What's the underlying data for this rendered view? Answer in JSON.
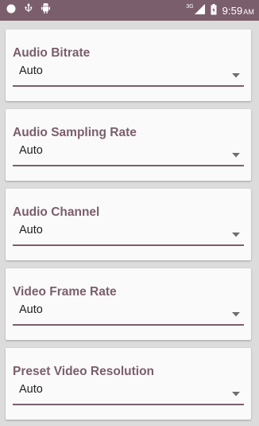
{
  "status_bar": {
    "network_label": "3G",
    "time": "9:59",
    "ampm": "AM"
  },
  "settings": [
    {
      "title": "Audio Bitrate",
      "value": "Auto"
    },
    {
      "title": "Audio Sampling Rate",
      "value": "Auto"
    },
    {
      "title": "Audio Channel",
      "value": "Auto"
    },
    {
      "title": "Video Frame Rate",
      "value": "Auto"
    },
    {
      "title": "Preset Video Resolution",
      "value": "Auto"
    }
  ],
  "colors": {
    "accent": "#7b5e6c",
    "status_bar": "#7b5e6c",
    "card_background": "#fafafa",
    "list_background": "#dcdcdc"
  },
  "icons": {
    "status_left": [
      "circle-icon",
      "usb-icon",
      "android-debug-icon"
    ],
    "status_right": [
      "signal-icon",
      "battery-icon"
    ],
    "spinner": "dropdown-arrow-icon"
  }
}
